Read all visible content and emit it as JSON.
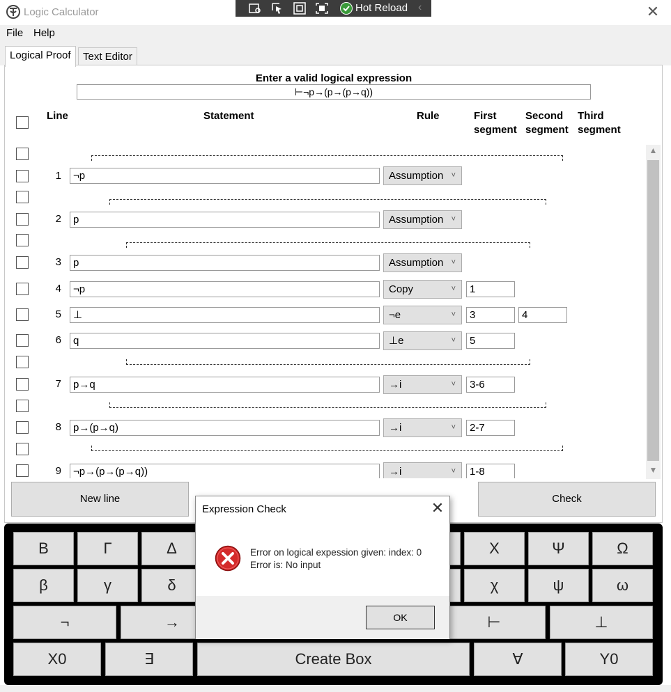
{
  "window": {
    "title": "Logic Calculator",
    "close_symbol": "✕"
  },
  "hot_reload": {
    "label": "Hot Reload",
    "chevron": "‹",
    "icons": [
      "select-element-icon",
      "pointer-icon",
      "layout-adorner-icon",
      "track-focus-icon"
    ],
    "status_icon": "check-circle-icon"
  },
  "menu": {
    "items": [
      "File",
      "Help"
    ]
  },
  "tabs": [
    {
      "label": "Logical Proof",
      "active": true
    },
    {
      "label": "Text Editor",
      "active": false
    }
  ],
  "proof": {
    "expression_label": "Enter a valid logical expression",
    "expression_value": "⊢¬p→(p→(p→q))",
    "headers": {
      "line": "Line",
      "statement": "Statement",
      "rule": "Rule",
      "first": [
        "First",
        "segment"
      ],
      "second": [
        "Second",
        "segment"
      ],
      "third": [
        "Third",
        "segment"
      ]
    },
    "lines": [
      {
        "num": "1",
        "statement": "¬p",
        "rule": "Assumption",
        "first": "",
        "second": ""
      },
      {
        "num": "2",
        "statement": "p",
        "rule": "Assumption",
        "first": "",
        "second": ""
      },
      {
        "num": "3",
        "statement": "p",
        "rule": "Assumption",
        "first": "",
        "second": ""
      },
      {
        "num": "4",
        "statement": "¬p",
        "rule": "Copy",
        "first": "1",
        "second": ""
      },
      {
        "num": "5",
        "statement": "⊥",
        "rule": "¬e",
        "first": "3",
        "second": "4"
      },
      {
        "num": "6",
        "statement": "q",
        "rule": "⊥e",
        "first": "5",
        "second": ""
      },
      {
        "num": "7",
        "statement": "p→q",
        "rule": "→i",
        "first": "3-6",
        "second": ""
      },
      {
        "num": "8",
        "statement": "p→(p→q)",
        "rule": "→i",
        "first": "2-7",
        "second": ""
      },
      {
        "num": "9",
        "statement": "¬p→(p→(p→q))",
        "rule": "→i",
        "first": "1-8",
        "second": ""
      }
    ],
    "scroll": {
      "up": "▲",
      "down": "▼"
    },
    "new_line_label": "New line",
    "check_label": "Check"
  },
  "keyboard": {
    "row1": [
      "Β",
      "Γ",
      "Δ",
      "",
      "Χ",
      "Ψ",
      "Ω"
    ],
    "row2": [
      "β",
      "γ",
      "δ",
      "",
      "χ",
      "ψ",
      "ω"
    ],
    "row3": [
      "¬",
      "→",
      "",
      "⊢",
      "⊥"
    ],
    "row4": [
      "X0",
      "∃",
      "Create Box",
      "∀",
      "Y0"
    ]
  },
  "dialog": {
    "title": "Expression Check",
    "close_symbol": "✕",
    "message_line1": "Error on logical expession given: index: 0",
    "message_line2": "Error is: No input",
    "ok_label": "OK",
    "icon": "error-icon"
  }
}
